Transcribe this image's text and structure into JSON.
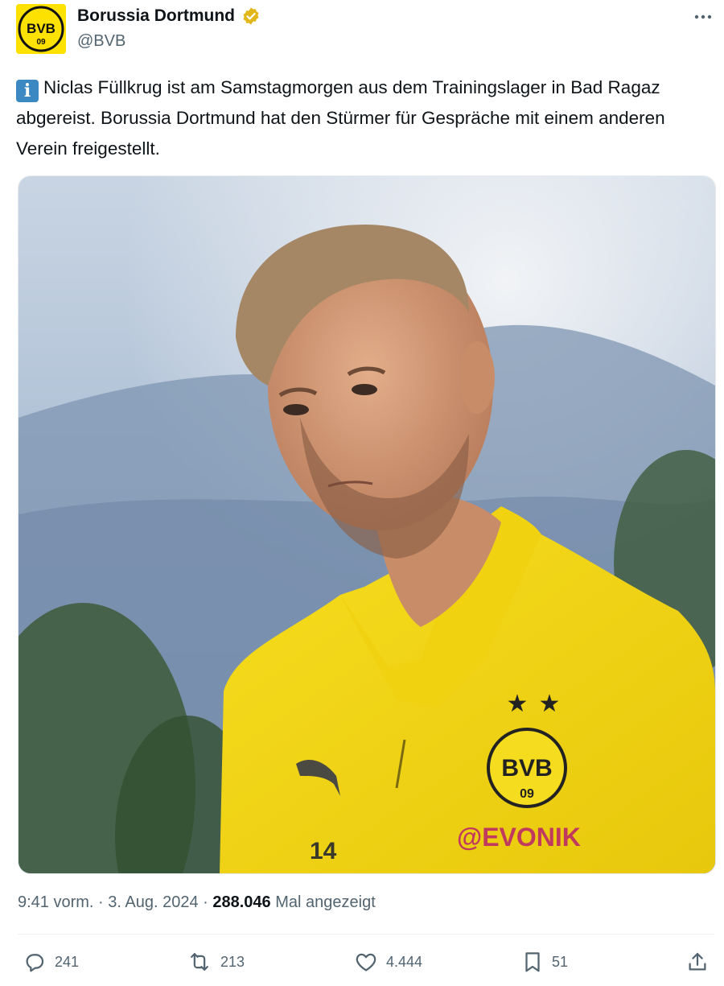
{
  "account": {
    "display_name": "Borussia Dortmund",
    "handle": "@BVB",
    "avatar_logo_text": "BVB 09",
    "verified_icon": "gold-verified-badge"
  },
  "tweet": {
    "info_emoji": "i",
    "text": "Niclas Füllkrug ist am Samstagmorgen aus dem Trainingslager in Bad Ragaz abgereist. Borussia Dortmund hat den Stürmer für Gespräche mit einem anderen Verein freigestellt.",
    "photo_jersey_text": {
      "badge": "BVB 09",
      "sponsor": "EVONIK",
      "number": "14"
    }
  },
  "meta": {
    "time": "9:41 vorm.",
    "sep1": " · ",
    "date": "3. Aug. 2024",
    "sep2": " · ",
    "views_count": "288.046",
    "views_label": " Mal angezeigt"
  },
  "actions": {
    "replies": "241",
    "retweets": "213",
    "likes": "4.444",
    "bookmarks": "51"
  },
  "colors": {
    "bvb_yellow": "#fde100",
    "text_primary": "#0f1419",
    "text_secondary": "#536471",
    "verified_gold": "#e2b719"
  }
}
